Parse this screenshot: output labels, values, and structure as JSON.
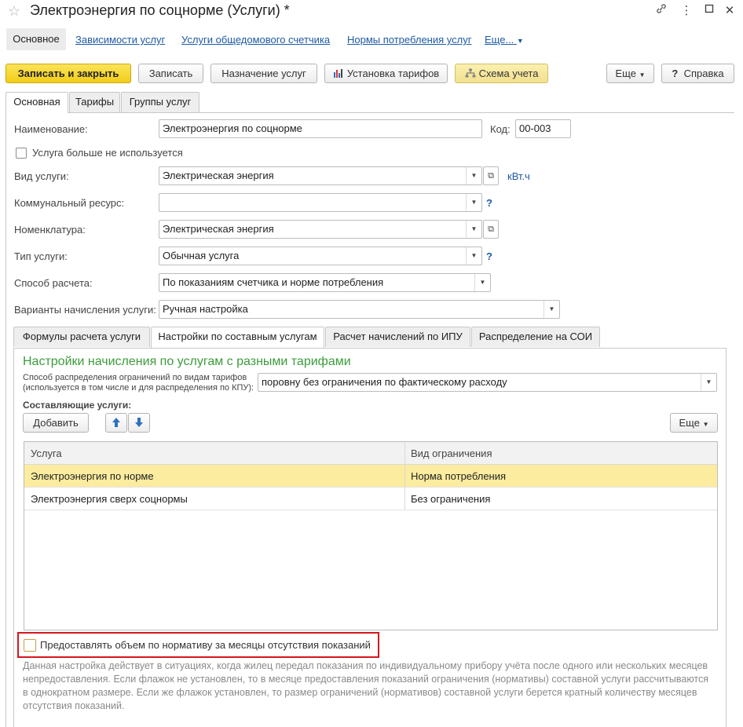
{
  "window": {
    "title": "Электроэнергия по соцнорме (Услуги) *",
    "star_icon": "star-icon",
    "link_icon": "link-icon",
    "more_icon": "more-vertical-icon",
    "minimize_icon": "minimize-icon",
    "maximize_icon": "maximize-icon",
    "close_icon": "close-icon"
  },
  "nav": {
    "active": "Основное",
    "links": [
      "Зависимости услуг",
      "Услуги общедомового счетчика",
      "Нормы потребления услуг",
      "Еще..."
    ]
  },
  "toolbar": {
    "save_close": "Записать и закрыть",
    "save": "Записать",
    "assign": "Назначение услуг",
    "tariffs": "Установка тарифов",
    "scheme": "Схема учета",
    "more": "Еще",
    "help": "Справка",
    "help_icon": "?"
  },
  "tabs": [
    "Основная",
    "Тарифы",
    "Группы услуг"
  ],
  "form": {
    "name_label": "Наименование:",
    "name_value": "Электроэнергия по соцнорме",
    "code_label": "Код:",
    "code_value": "00-003",
    "unused_label": "Услуга больше не используется",
    "service_type_label": "Вид услуги:",
    "service_type_value": "Электрическая энергия",
    "unit": "кВт.ч",
    "resource_label": "Коммунальный ресурс:",
    "resource_value": "",
    "nomenclature_label": "Номенклатура:",
    "nomenclature_value": "Электрическая энергия",
    "kind_label": "Тип услуги:",
    "kind_value": "Обычная услуга",
    "calc_label": "Способ расчета:",
    "calc_value": "По показаниям счетчика и норме потребления",
    "accrual_label": "Варианты начисления услуги:",
    "accrual_value": "Ручная настройка",
    "help_mark": "?"
  },
  "subtabs": [
    "Формулы расчета услуги",
    "Настройки по составным услугам",
    "Расчет начислений по ИПУ",
    "Распределение на СОИ"
  ],
  "subpanel": {
    "heading": "Настройки начисления по услугам с разными тарифами",
    "dist_label_1": "Способ распределения ограничений по видам тарифов",
    "dist_label_2": "(используется в том числе и для распределения по КПУ):",
    "dist_value": "поровну без ограничения по фактическому расходу",
    "components_label": "Составляющие услуги:",
    "add_button": "Добавить",
    "more_button": "Еще",
    "grid": {
      "headers": [
        "Услуга",
        "Вид ограничения"
      ],
      "rows": [
        {
          "service": "Электроэнергия по норме",
          "limit": "Норма потребления"
        },
        {
          "service": "Электроэнергия сверх соцнормы",
          "limit": "Без ограничения"
        }
      ]
    },
    "provide_checkbox": "Предоставлять объем по нормативу за месяцы отсутствия показаний",
    "note": "Данная настройка действует в ситуациях, когда жилец передал показания по индивидуальному прибору учёта после одного или нескольких месяцев непредоставления. Если флажок не установлен, то в месяце предоставления показаний ограничения (нормативы) составной услуги рассчитываются в однократном размере. Если же флажок установлен, то размер ограничений (нормативов) составной услуги берется кратный количеству месяцев отсутствия показаний."
  }
}
